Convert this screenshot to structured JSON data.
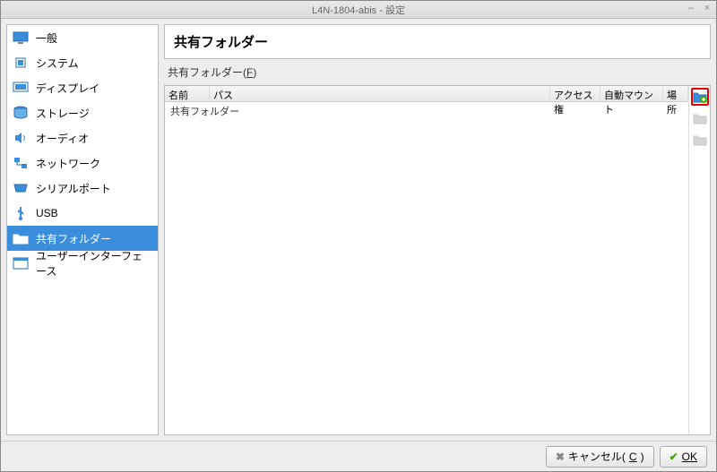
{
  "window": {
    "title": "L4N-1804-abis - 設定"
  },
  "sidebar": {
    "items": [
      {
        "label": "一般"
      },
      {
        "label": "システム"
      },
      {
        "label": "ディスプレイ"
      },
      {
        "label": "ストレージ"
      },
      {
        "label": "オーディオ"
      },
      {
        "label": "ネットワーク"
      },
      {
        "label": "シリアルポート"
      },
      {
        "label": "USB"
      },
      {
        "label": "共有フォルダー"
      },
      {
        "label": "ユーザーインターフェース"
      }
    ]
  },
  "main": {
    "heading": "共有フォルダー",
    "group_label_pre": "共有フォルダー(",
    "group_label_key": "F",
    "group_label_post": ")",
    "columns": {
      "name": "名前",
      "path": "パス",
      "access": "アクセス権",
      "automount": "自動マウント",
      "location": "場所"
    },
    "group_row": "共有フォルダー"
  },
  "footer": {
    "cancel_pre": "キャンセル(",
    "cancel_key": "C",
    "cancel_post": ")",
    "ok": "OK"
  }
}
